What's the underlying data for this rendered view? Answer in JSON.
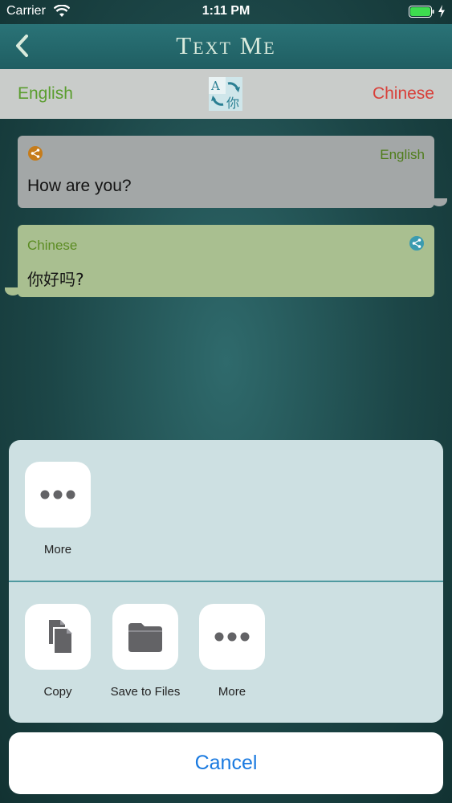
{
  "status_bar": {
    "carrier": "Carrier",
    "time": "1:11 PM"
  },
  "nav": {
    "title": "Text Me",
    "back_icon": "chevron-left-icon"
  },
  "language_bar": {
    "source_language": "English",
    "target_language": "Chinese",
    "swap_icon": "translate-swap-icon",
    "source_color": "#5a9d2e",
    "target_color": "#d8403a"
  },
  "source_bubble": {
    "language": "English",
    "text": "How are you?",
    "icon": "share-icon"
  },
  "translation_bubble": {
    "language": "Chinese",
    "text": "你好吗?",
    "icon": "share-icon"
  },
  "share_sheet": {
    "top_row": [
      {
        "label": "More",
        "icon": "ellipsis-icon"
      }
    ],
    "action_row": [
      {
        "label": "Copy",
        "icon": "copy-icon"
      },
      {
        "label": "Save to Files",
        "icon": "folder-icon"
      },
      {
        "label": "More",
        "icon": "ellipsis-icon"
      }
    ]
  },
  "cancel_label": "Cancel",
  "colors": {
    "accent_blue": "#1a7ae0",
    "nav_teal": "#1f5e62"
  }
}
